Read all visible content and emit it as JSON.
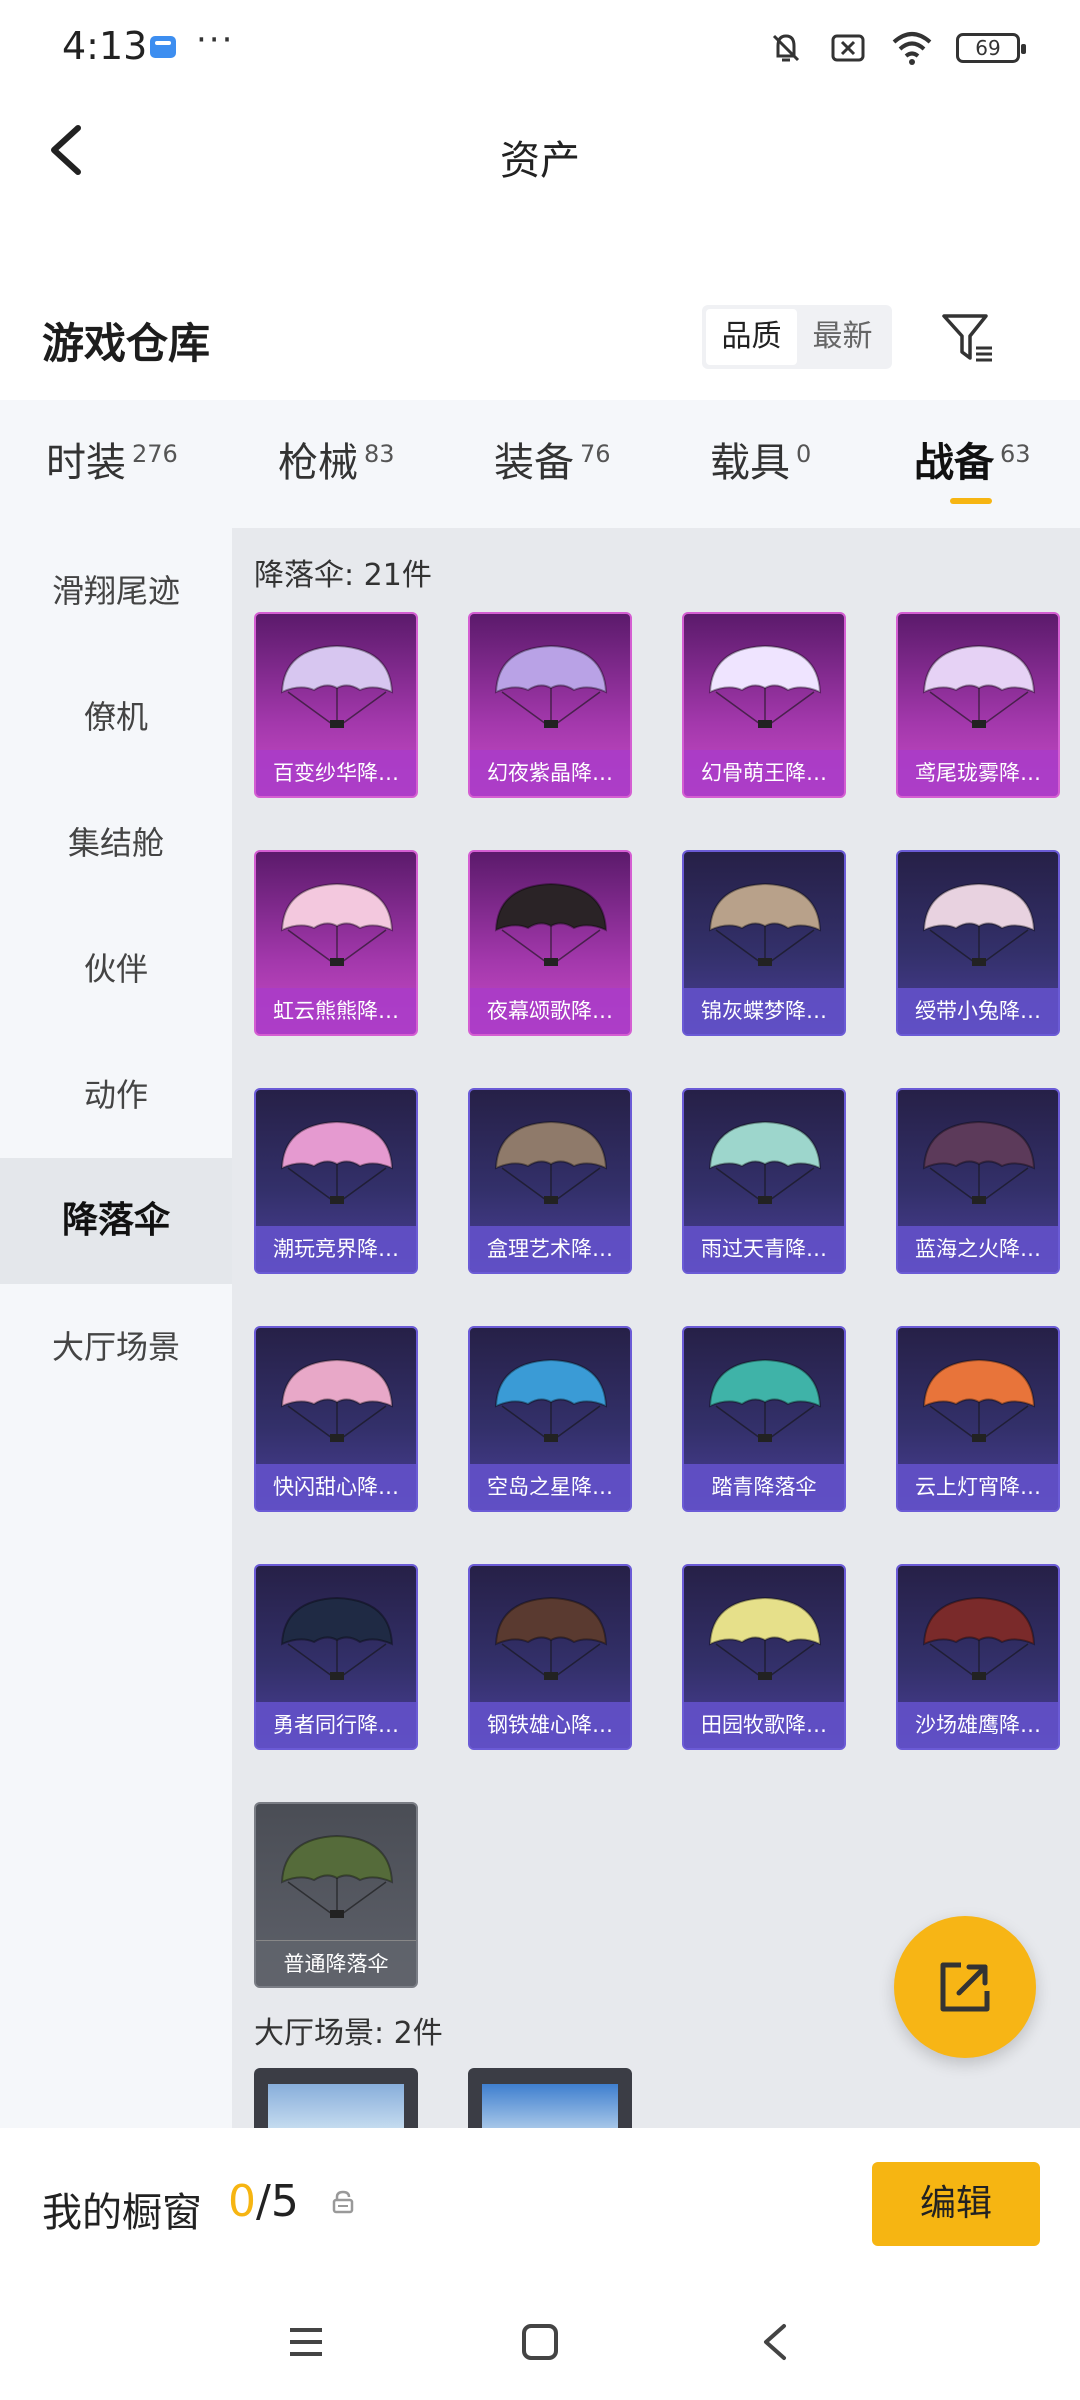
{
  "status_bar": {
    "time": "4:13",
    "more": "···",
    "battery": "69"
  },
  "header": {
    "title": "资产"
  },
  "warehouse": {
    "title": "游戏仓库",
    "sort_options": [
      {
        "label": "品质",
        "active": true
      },
      {
        "label": "最新",
        "active": false
      }
    ]
  },
  "tabs": [
    {
      "label": "时装",
      "count": "276"
    },
    {
      "label": "枪械",
      "count": "83"
    },
    {
      "label": "装备",
      "count": "76"
    },
    {
      "label": "载具",
      "count": "0"
    },
    {
      "label": "战备",
      "count": "63",
      "active": true
    }
  ],
  "sidebar": {
    "items": [
      {
        "label": "滑翔尾迹"
      },
      {
        "label": "僚机"
      },
      {
        "label": "集结舱"
      },
      {
        "label": "伙伴"
      },
      {
        "label": "动作"
      },
      {
        "label": "降落伞",
        "active": true
      },
      {
        "label": "大厅场景"
      }
    ]
  },
  "sections": {
    "parachutes": {
      "title": "降落伞: 21件",
      "items": [
        {
          "name": "百变纱华降…",
          "rarity": "pink"
        },
        {
          "name": "幻夜紫晶降…",
          "rarity": "pink"
        },
        {
          "name": "幻骨萌王降…",
          "rarity": "pink"
        },
        {
          "name": "鸢尾珑雾降…",
          "rarity": "pink"
        },
        {
          "name": "虹云熊熊降…",
          "rarity": "pink"
        },
        {
          "name": "夜幕颂歌降…",
          "rarity": "pink"
        },
        {
          "name": "锦灰蝶梦降…",
          "rarity": "blue"
        },
        {
          "name": "绶带小兔降…",
          "rarity": "blue"
        },
        {
          "name": "潮玩竞界降…",
          "rarity": "blue"
        },
        {
          "name": "盒理艺术降…",
          "rarity": "blue"
        },
        {
          "name": "雨过天青降…",
          "rarity": "blue"
        },
        {
          "name": "蓝海之火降…",
          "rarity": "blue"
        },
        {
          "name": "快闪甜心降…",
          "rarity": "blue"
        },
        {
          "name": "空岛之星降…",
          "rarity": "blue"
        },
        {
          "name": "踏青降落伞",
          "rarity": "blue"
        },
        {
          "name": "云上灯宵降…",
          "rarity": "blue"
        },
        {
          "name": "勇者同行降…",
          "rarity": "blue"
        },
        {
          "name": "钢铁雄心降…",
          "rarity": "blue"
        },
        {
          "name": "田园牧歌降…",
          "rarity": "blue"
        },
        {
          "name": "沙场雄鹰降…",
          "rarity": "blue"
        },
        {
          "name": "普通降落伞",
          "rarity": "gray"
        }
      ]
    },
    "lobby": {
      "title": "大厅场景: 2件"
    }
  },
  "showcase": {
    "label": "我的橱窗",
    "current": "0",
    "total": "/5",
    "edit_label": "编辑"
  },
  "colors": {
    "accent": "#f6b512",
    "epic": "#c94cc6",
    "rare": "#6b5bd6",
    "common": "#60636c"
  }
}
